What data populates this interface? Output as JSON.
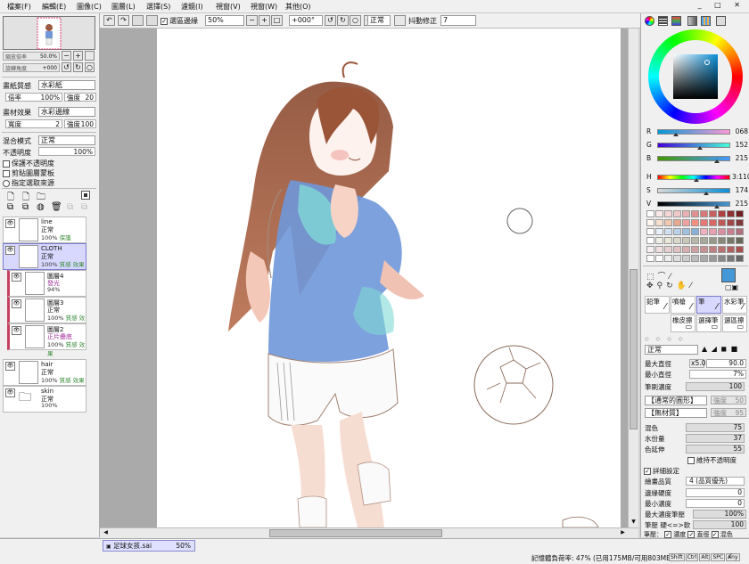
{
  "menu": [
    "檔案(F)",
    "編輯(E)",
    "圖像(C)",
    "圖層(L)",
    "選擇(S)",
    "濾鏡(I)",
    "視窗(V)",
    "視窗(W)",
    "其他(O)"
  ],
  "toolbar": {
    "antialias_label": "選區邊緣",
    "zoom_value": "50%",
    "rotate_value": "+000°",
    "mode_value": "正常",
    "stabilizer_label": "抖動修正",
    "stabilizer_value": "7"
  },
  "navigator": {
    "zoom_label": "縮放倍率",
    "zoom_value": "50.0%",
    "angle_label": "旋轉角度",
    "angle_value": "+000"
  },
  "paper": {
    "texture_label": "畫紙質感",
    "texture_value": "水彩紙",
    "scale_label": "倍率",
    "scale_value": "100%",
    "intensity_label": "強度",
    "intensity_value": "20",
    "effect_label": "畫材效果",
    "effect_value": "水彩邊線",
    "width_label": "寬度",
    "width_value": "2",
    "effect_intensity_label": "強度",
    "effect_intensity_value": "100"
  },
  "blend": {
    "mode_label": "混合模式",
    "mode_value": "正常",
    "opacity_label": "不透明度",
    "opacity_value": "100%",
    "protect_label": "保護不透明度",
    "clip_label": "剪貼圖層蒙板",
    "source_label": "指定選取來源"
  },
  "layers": [
    {
      "name": "line",
      "mode": "正常",
      "opacity": "100%",
      "extra": "保護",
      "extra_color": "#3a8c3a",
      "selected": false,
      "type": "layer"
    },
    {
      "name": "CLOTH",
      "mode": "正常",
      "opacity": "100%",
      "extra": "質感 效果",
      "extra_color": "#3a8c3a",
      "selected": true,
      "type": "layer"
    },
    {
      "name": "圖層4",
      "mode": "發光",
      "opacity": "94%",
      "extra": "",
      "extra_color": "#a0309a",
      "selected": false,
      "type": "clip"
    },
    {
      "name": "圖層3",
      "mode": "正常",
      "opacity": "100%",
      "extra": "質感 效果",
      "extra_color": "#3a8c3a",
      "selected": false,
      "type": "clip"
    },
    {
      "name": "圖層2",
      "mode": "正片疊底",
      "opacity": "100%",
      "extra": "質感 效果",
      "extra_color": "#3a8c3a",
      "selected": false,
      "type": "clip"
    },
    {
      "name": "hair",
      "mode": "正常",
      "opacity": "100%",
      "extra": "質感 效果",
      "extra_color": "#3a8c3a",
      "selected": false,
      "type": "layer"
    },
    {
      "name": "skin",
      "mode": "正常",
      "opacity": "100%",
      "extra": "",
      "extra_color": "#3a8c3a",
      "selected": false,
      "type": "folder"
    }
  ],
  "color": {
    "current_hex": "#4498d7",
    "sliders": [
      {
        "label": "R",
        "value": "068",
        "gradient": "linear-gradient(90deg,#0098d7,#ff98d7)"
      },
      {
        "label": "G",
        "value": "152",
        "gradient": "linear-gradient(90deg,#4400d7,#44ffd7)"
      },
      {
        "label": "B",
        "value": "215",
        "gradient": "linear-gradient(90deg,#449800,#4498ff)"
      },
      {
        "label": "H",
        "value": "3:110",
        "gradient": "linear-gradient(90deg,#f00,#ff0,#0f0,#0ff,#00f,#f0f,#f00)"
      },
      {
        "label": "S",
        "value": "174",
        "gradient": "linear-gradient(90deg,#d7d7d7,#0a8fd7)"
      },
      {
        "label": "V",
        "value": "215",
        "gradient": "linear-gradient(90deg,#000,#4498d7)"
      }
    ]
  },
  "tools": {
    "brushes": [
      "鉛筆",
      "噴槍",
      "筆",
      "水彩筆"
    ],
    "brushes2": [
      "橡皮擦",
      "選擇筆",
      "選區擦"
    ]
  },
  "brush": {
    "mode_value": "正常",
    "max_size_label": "最大直徑",
    "max_size_mult": "x5.0",
    "max_size_value": "90.0",
    "min_size_label": "最小直徑",
    "min_size_value": "7%",
    "density_label": "筆刷濃度",
    "density_value": "100",
    "shape_value": "【通常的圓形】",
    "shape_strength_label": "強度",
    "shape_strength_value": "50",
    "texture_value": "【無材質】",
    "texture_strength_label": "強度",
    "texture_strength_value": "95",
    "blend_label": "混色",
    "blend_value": "75",
    "dilution_label": "水份量",
    "dilution_value": "37",
    "persistence_label": "色延伸",
    "persistence_value": "55",
    "keep_opacity_label": "維持不透明度",
    "advanced_label": "詳細設定",
    "quality_label": "繪畫品質",
    "quality_value": "4 (品質優先)",
    "edge_hardness_label": "邊緣硬度",
    "edge_hardness_value": "0",
    "min_density_label": "最小濃度",
    "min_density_value": "0",
    "max_dens_prs_label": "最大濃度筆壓",
    "max_dens_prs_value": "100%",
    "hard_soft_label": "筆壓 硬<=>軟",
    "hard_soft_value": "100",
    "pressure_label": "筆壓：",
    "pressure_density": "濃度",
    "pressure_size": "直徑",
    "pressure_blend": "混色"
  },
  "status": {
    "tab_label": "足球女孩.sai",
    "tab_zoom": "50%",
    "memory_text": "記憶體負荷率: 47% (已用175MB/可用803MB)",
    "keys": [
      "Shift",
      "Ctrl",
      "Alt",
      "SPC",
      "Any"
    ]
  }
}
